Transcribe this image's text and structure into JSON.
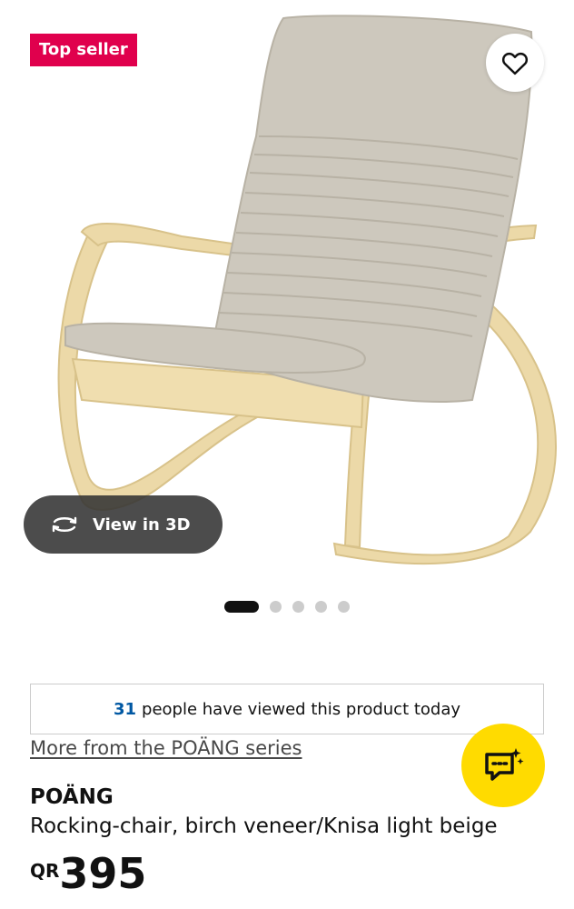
{
  "badge": {
    "label": "Top seller",
    "color": "#e0004d"
  },
  "favorite": {
    "icon": "heart-icon"
  },
  "view3d": {
    "label": "View in 3D",
    "icon": "rotate-3d-icon"
  },
  "carousel": {
    "total": 5,
    "active": 1
  },
  "viewed": {
    "count": "31",
    "text": "people have viewed this product today"
  },
  "series_link": "More from the POÄNG series",
  "assistant": {
    "icon": "chat-sparkle-icon",
    "color": "#ffdb00"
  },
  "product": {
    "name": "POÄNG",
    "description": "Rocking-chair, birch veneer/Knisa light beige",
    "currency": "QR",
    "price": "395"
  }
}
